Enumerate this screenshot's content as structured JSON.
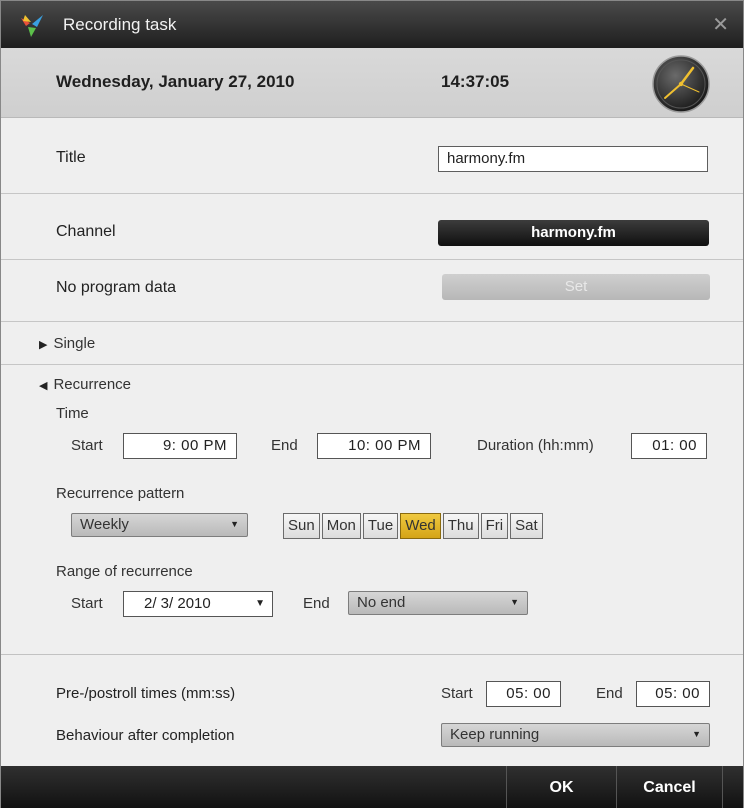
{
  "window": {
    "title": "Recording task",
    "close_symbol": "✕"
  },
  "header": {
    "date": "Wednesday, January 27, 2010",
    "time": "14:37:05"
  },
  "title_row": {
    "label": "Title",
    "value": "harmony.fm"
  },
  "channel_row": {
    "label": "Channel",
    "button": "harmony.fm"
  },
  "program_row": {
    "label": "No program data",
    "button": "Set"
  },
  "single": {
    "label": "Single",
    "expanded": false
  },
  "recurrence": {
    "label": "Recurrence",
    "expanded": true,
    "time": {
      "label": "Time",
      "start_label": "Start",
      "start_value": "9: 00  PM",
      "end_label": "End",
      "end_value": "10: 00  PM",
      "duration_label": "Duration (hh:mm)",
      "duration_value": "01: 00"
    },
    "pattern": {
      "label": "Recurrence pattern",
      "selected": "Weekly",
      "days": [
        {
          "label": "Sun",
          "active": false
        },
        {
          "label": "Mon",
          "active": false
        },
        {
          "label": "Tue",
          "active": false
        },
        {
          "label": "Wed",
          "active": true
        },
        {
          "label": "Thu",
          "active": false
        },
        {
          "label": "Fri",
          "active": false
        },
        {
          "label": "Sat",
          "active": false
        }
      ]
    },
    "range": {
      "label": "Range of recurrence",
      "start_label": "Start",
      "start_value": "2/  3/ 2010",
      "end_label": "End",
      "end_value": "No end"
    }
  },
  "preroll": {
    "label": "Pre-/postroll times (mm:ss)",
    "start_label": "Start",
    "start_value": "05: 00",
    "end_label": "End",
    "end_value": "05: 00"
  },
  "behaviour": {
    "label": "Behaviour after completion",
    "value": "Keep running"
  },
  "buttons": {
    "ok": "OK",
    "cancel": "Cancel"
  },
  "colors": {
    "active_day": "#e2b52a",
    "title_bar": "#2b2b2b"
  }
}
